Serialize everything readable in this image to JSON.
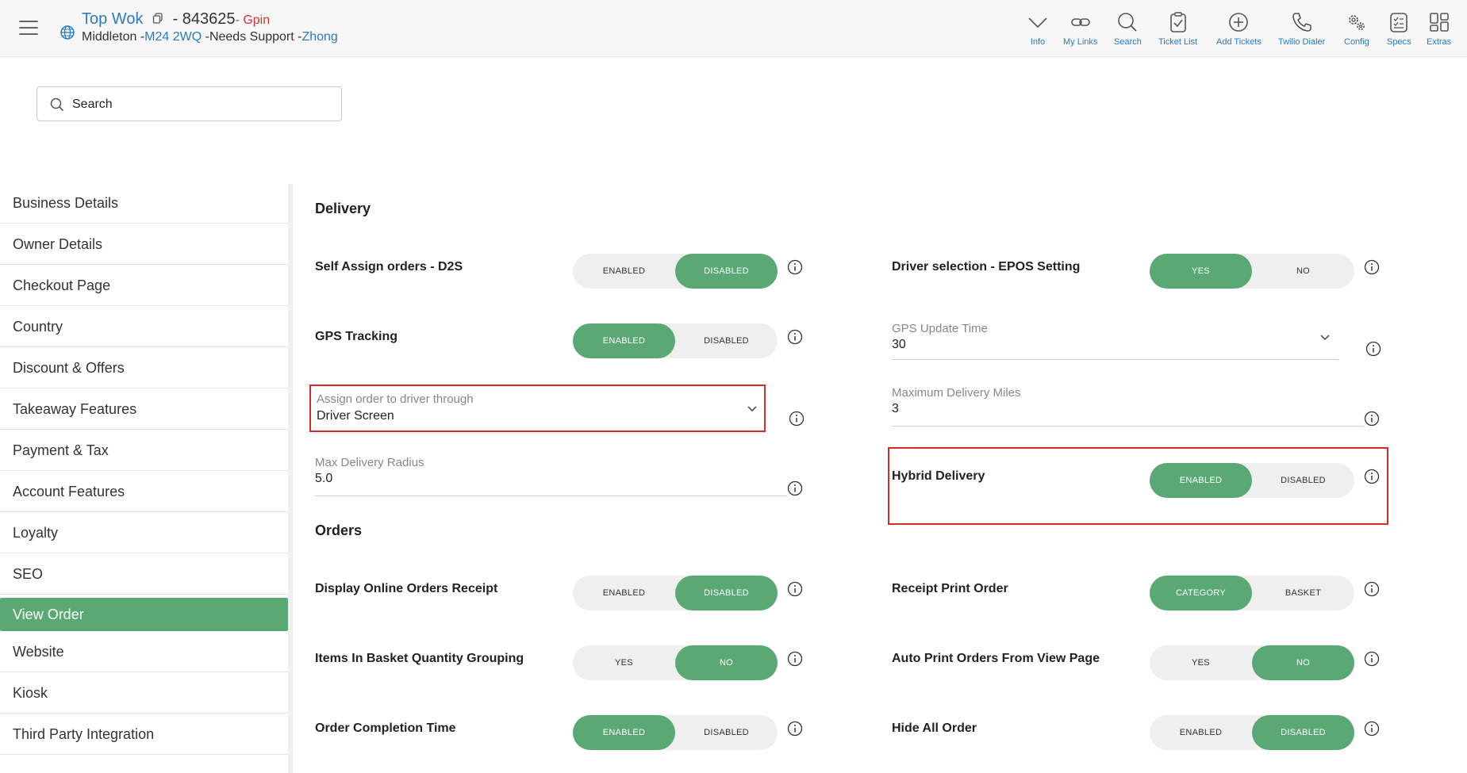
{
  "header": {
    "shop_name": "Top Wok",
    "shop_id": "- 843625",
    "gpin": "- Gpin",
    "location": "Middleton -",
    "postcode": "M24 2WQ",
    "status": " -Needs Support -",
    "agent": "Zhong",
    "tools": [
      {
        "label": "Info",
        "icon": "chevron-down-icon"
      },
      {
        "label": "My Links",
        "icon": "link-icon"
      },
      {
        "label": "Search",
        "icon": "search-icon"
      },
      {
        "label": "Ticket List",
        "icon": "clipboard-check-icon"
      },
      {
        "label": "Add Tickets",
        "icon": "plus-circle-icon"
      },
      {
        "label": "Twilio Dialer",
        "icon": "phone-icon"
      },
      {
        "label": "Config",
        "icon": "gears-icon"
      },
      {
        "label": "Specs",
        "icon": "checklist-icon"
      },
      {
        "label": "Extras",
        "icon": "grid-icon"
      }
    ]
  },
  "search": {
    "placeholder": "Search"
  },
  "sidebar": {
    "items": [
      {
        "label": "Business Details"
      },
      {
        "label": "Owner Details"
      },
      {
        "label": "Checkout Page"
      },
      {
        "label": "Country"
      },
      {
        "label": "Discount & Offers"
      },
      {
        "label": "Takeaway Features"
      },
      {
        "label": "Payment & Tax"
      },
      {
        "label": "Account Features"
      },
      {
        "label": "Loyalty"
      },
      {
        "label": "SEO"
      },
      {
        "label": "View Order",
        "active": true
      },
      {
        "label": "Website"
      },
      {
        "label": "Kiosk"
      },
      {
        "label": "Third Party Integration"
      }
    ]
  },
  "delivery": {
    "title": "Delivery",
    "self_assign": {
      "label": "Self Assign orders - D2S",
      "opt1": "ENABLED",
      "opt2": "DISABLED",
      "selected": "DISABLED"
    },
    "driver_selection": {
      "label": "Driver selection - EPOS Setting",
      "opt1": "YES",
      "opt2": "NO",
      "selected": "YES"
    },
    "gps_tracking": {
      "label": "GPS Tracking",
      "opt1": "ENABLED",
      "opt2": "DISABLED",
      "selected": "ENABLED"
    },
    "gps_update_time": {
      "label": "GPS Update Time",
      "value": "30"
    },
    "assign_order": {
      "label": "Assign order to driver through",
      "value": "Driver Screen"
    },
    "max_delivery_miles": {
      "label": "Maximum Delivery Miles",
      "value": "3"
    },
    "max_delivery_radius": {
      "label": "Max Delivery Radius",
      "value": "5.0"
    },
    "hybrid_delivery": {
      "label": "Hybrid Delivery",
      "opt1": "ENABLED",
      "opt2": "DISABLED",
      "selected": "ENABLED"
    }
  },
  "orders": {
    "title": "Orders",
    "display_receipt": {
      "label": "Display Online Orders Receipt",
      "opt1": "ENABLED",
      "opt2": "DISABLED",
      "selected": "DISABLED"
    },
    "receipt_print_order": {
      "label": "Receipt Print Order",
      "opt1": "CATEGORY",
      "opt2": "BASKET",
      "selected": "CATEGORY"
    },
    "basket_grouping": {
      "label": "Items In Basket Quantity Grouping",
      "opt1": "YES",
      "opt2": "NO",
      "selected": "NO"
    },
    "auto_print": {
      "label": "Auto Print Orders From View Page",
      "opt1": "YES",
      "opt2": "NO",
      "selected": "NO"
    },
    "completion_time": {
      "label": "Order Completion Time",
      "opt1": "ENABLED",
      "opt2": "DISABLED",
      "selected": "ENABLED"
    },
    "hide_all_order": {
      "label": "Hide All Order",
      "opt1": "ENABLED",
      "opt2": "DISABLED",
      "selected": "DISABLED"
    }
  },
  "colors": {
    "accent": "#5aa874",
    "link": "#2b7bbf",
    "highlight": "#d12b2b",
    "gpin": "#d13232"
  }
}
